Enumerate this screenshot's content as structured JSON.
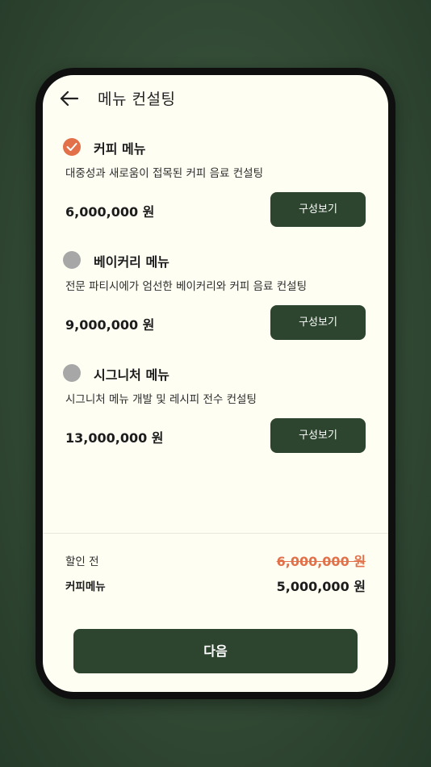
{
  "header": {
    "title": "메뉴 컨설팅",
    "back_icon": "arrow-left-icon"
  },
  "options": [
    {
      "name": "커피 메뉴",
      "description": "대중성과 새로움이 접목된 커피 음료 컨설팅",
      "price": "6,000,000 원",
      "button_label": "구성보기",
      "selected": true
    },
    {
      "name": "베이커리 메뉴",
      "description": "전문 파티시에가 엄선한 베이커리와 커피 음료 컨설팅",
      "price": "9,000,000 원",
      "button_label": "구성보기",
      "selected": false
    },
    {
      "name": "시그니처 메뉴",
      "description": "시그니처 메뉴 개발 및 레시피 전수 컨설팅",
      "price": "13,000,000 원",
      "button_label": "구성보기",
      "selected": false
    }
  ],
  "summary": {
    "before_discount_label": "할인 전",
    "before_discount_value": "6,000,000 원",
    "selected_label": "커피메뉴",
    "selected_value": "5,000,000 원"
  },
  "next_button_label": "다음",
  "colors": {
    "primary": "#2d452f",
    "accent": "#e2714a",
    "radio_unselected": "#a7a7a7",
    "screen_bg": "#fefef3"
  }
}
